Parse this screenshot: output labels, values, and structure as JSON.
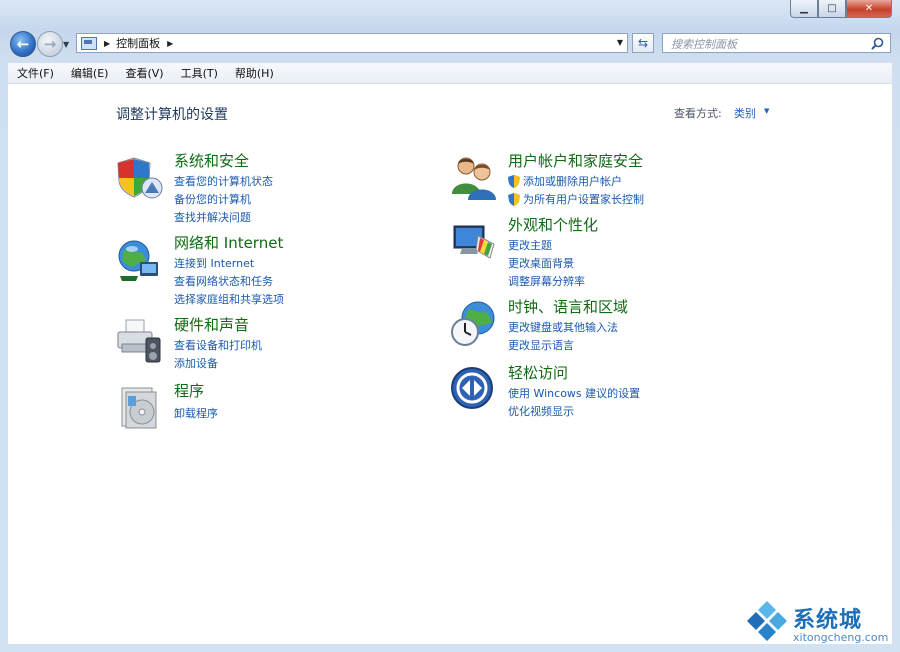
{
  "window": {
    "title": "",
    "min_label": "▁",
    "max_label": "□",
    "close_label": "✕"
  },
  "address": {
    "path": "控制面板",
    "search_placeholder": "搜索控制面板"
  },
  "menu": {
    "items": [
      "文件(F)",
      "编辑(E)",
      "查看(V)",
      "工具(T)",
      "帮助(H)"
    ]
  },
  "main": {
    "title": "调整计算机的设置",
    "view_by_label": "查看方式:",
    "view_by_value": "类别"
  },
  "categories": [
    {
      "title": "系统和安全",
      "icon": "shield-icon",
      "links": [
        "查看您的计算机状态",
        "备份您的计算机",
        "查找并解决问题"
      ]
    },
    {
      "title": "网络和 Internet",
      "icon": "network-globe-icon",
      "links": [
        "连接到 Internet",
        "查看网络状态和任务",
        "选择家庭组和共享选项"
      ]
    },
    {
      "title": "硬件和声音",
      "icon": "printer-speaker-icon",
      "links": [
        "查看设备和打印机",
        "添加设备"
      ]
    },
    {
      "title": "程序",
      "icon": "programs-icon",
      "links": [
        "卸载程序"
      ]
    },
    {
      "title": "用户帐户和家庭安全",
      "icon": "users-icon",
      "links": [
        "添加或删除用户帐户",
        "为所有用户设置家长控制"
      ]
    },
    {
      "title": "外观和个性化",
      "icon": "appearance-icon",
      "links": [
        "更改主题",
        "更改桌面背景",
        "调整屏幕分辨率"
      ]
    },
    {
      "title": "时钟、语言和区域",
      "icon": "clock-globe-icon",
      "links": [
        "更改键盘或其他输入法",
        "更改显示语言"
      ]
    },
    {
      "title": "轻松访问",
      "icon": "ease-of-access-icon",
      "links": [
        "使用 Wincows 建议的设置",
        "优化视频显示"
      ]
    }
  ],
  "watermark": {
    "name": "系统城",
    "url": "xitongcheng.com"
  }
}
